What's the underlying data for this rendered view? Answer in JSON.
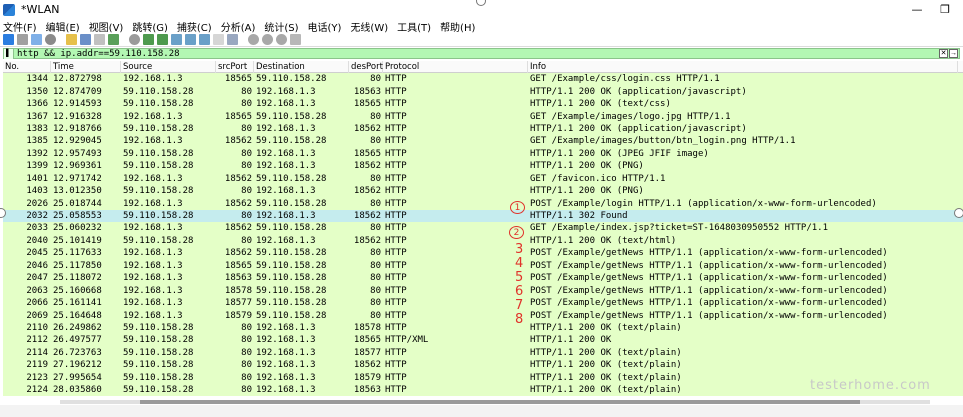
{
  "window": {
    "title": "*WLAN",
    "min": "—",
    "restore": "❐"
  },
  "menu": [
    "文件(F)",
    "编辑(E)",
    "视图(V)",
    "跳转(G)",
    "捕获(C)",
    "分析(A)",
    "统计(S)",
    "电话(Y)",
    "无线(W)",
    "工具(T)",
    "帮助(H)"
  ],
  "filter": {
    "value": "http && ip.addr==59.110.158.28"
  },
  "columns": [
    "No.",
    "Time",
    "Source",
    "srcPort",
    "Destination",
    "desPort",
    "Protocol",
    "Info"
  ],
  "rows": [
    {
      "no": "1344",
      "time": "12.872798",
      "src": "192.168.1.3",
      "sport": "18565",
      "dst": "59.110.158.28",
      "dport": "80",
      "proto": "HTTP",
      "info": "GET /Example/css/login.css HTTP/1.1"
    },
    {
      "no": "1350",
      "time": "12.874709",
      "src": "59.110.158.28",
      "sport": "80",
      "dst": "192.168.1.3",
      "dport": "18563",
      "proto": "HTTP",
      "info": "HTTP/1.1 200 OK  (application/javascript)"
    },
    {
      "no": "1366",
      "time": "12.914593",
      "src": "59.110.158.28",
      "sport": "80",
      "dst": "192.168.1.3",
      "dport": "18565",
      "proto": "HTTP",
      "info": "HTTP/1.1 200 OK  (text/css)"
    },
    {
      "no": "1367",
      "time": "12.916328",
      "src": "192.168.1.3",
      "sport": "18565",
      "dst": "59.110.158.28",
      "dport": "80",
      "proto": "HTTP",
      "info": "GET /Example/images/logo.jpg HTTP/1.1"
    },
    {
      "no": "1383",
      "time": "12.918766",
      "src": "59.110.158.28",
      "sport": "80",
      "dst": "192.168.1.3",
      "dport": "18562",
      "proto": "HTTP",
      "info": "HTTP/1.1 200 OK  (application/javascript)"
    },
    {
      "no": "1385",
      "time": "12.929045",
      "src": "192.168.1.3",
      "sport": "18562",
      "dst": "59.110.158.28",
      "dport": "80",
      "proto": "HTTP",
      "info": "GET /Example/images/button/btn_login.png HTTP/1.1"
    },
    {
      "no": "1392",
      "time": "12.957493",
      "src": "59.110.158.28",
      "sport": "80",
      "dst": "192.168.1.3",
      "dport": "18565",
      "proto": "HTTP",
      "info": "HTTP/1.1 200 OK  (JPEG JFIF image)"
    },
    {
      "no": "1399",
      "time": "12.969361",
      "src": "59.110.158.28",
      "sport": "80",
      "dst": "192.168.1.3",
      "dport": "18562",
      "proto": "HTTP",
      "info": "HTTP/1.1 200 OK  (PNG)"
    },
    {
      "no": "1401",
      "time": "12.971742",
      "src": "192.168.1.3",
      "sport": "18562",
      "dst": "59.110.158.28",
      "dport": "80",
      "proto": "HTTP",
      "info": "GET /favicon.ico HTTP/1.1"
    },
    {
      "no": "1403",
      "time": "13.012350",
      "src": "59.110.158.28",
      "sport": "80",
      "dst": "192.168.1.3",
      "dport": "18562",
      "proto": "HTTP",
      "info": "HTTP/1.1 200 OK  (PNG)"
    },
    {
      "no": "2026",
      "time": "25.018744",
      "src": "192.168.1.3",
      "sport": "18562",
      "dst": "59.110.158.28",
      "dport": "80",
      "proto": "HTTP",
      "info": "POST /Example/login HTTP/1.1  (application/x-www-form-urlencoded)"
    },
    {
      "no": "2032",
      "time": "25.058553",
      "src": "59.110.158.28",
      "sport": "80",
      "dst": "192.168.1.3",
      "dport": "18562",
      "proto": "HTTP",
      "info": "HTTP/1.1 302 Found",
      "selected": true
    },
    {
      "no": "2033",
      "time": "25.060232",
      "src": "192.168.1.3",
      "sport": "18562",
      "dst": "59.110.158.28",
      "dport": "80",
      "proto": "HTTP",
      "info": "GET /Example/index.jsp?ticket=ST-1648030950552 HTTP/1.1"
    },
    {
      "no": "2040",
      "time": "25.101419",
      "src": "59.110.158.28",
      "sport": "80",
      "dst": "192.168.1.3",
      "dport": "18562",
      "proto": "HTTP",
      "info": "HTTP/1.1 200 OK  (text/html)"
    },
    {
      "no": "2045",
      "time": "25.117633",
      "src": "192.168.1.3",
      "sport": "18562",
      "dst": "59.110.158.28",
      "dport": "80",
      "proto": "HTTP",
      "info": "POST /Example/getNews HTTP/1.1  (application/x-www-form-urlencoded)"
    },
    {
      "no": "2046",
      "time": "25.117850",
      "src": "192.168.1.3",
      "sport": "18565",
      "dst": "59.110.158.28",
      "dport": "80",
      "proto": "HTTP",
      "info": "POST /Example/getNews HTTP/1.1  (application/x-www-form-urlencoded)"
    },
    {
      "no": "2047",
      "time": "25.118072",
      "src": "192.168.1.3",
      "sport": "18563",
      "dst": "59.110.158.28",
      "dport": "80",
      "proto": "HTTP",
      "info": "POST /Example/getNews HTTP/1.1  (application/x-www-form-urlencoded)"
    },
    {
      "no": "2063",
      "time": "25.160668",
      "src": "192.168.1.3",
      "sport": "18578",
      "dst": "59.110.158.28",
      "dport": "80",
      "proto": "HTTP",
      "info": "POST /Example/getNews HTTP/1.1  (application/x-www-form-urlencoded)"
    },
    {
      "no": "2066",
      "time": "25.161141",
      "src": "192.168.1.3",
      "sport": "18577",
      "dst": "59.110.158.28",
      "dport": "80",
      "proto": "HTTP",
      "info": "POST /Example/getNews HTTP/1.1  (application/x-www-form-urlencoded)"
    },
    {
      "no": "2069",
      "time": "25.164648",
      "src": "192.168.1.3",
      "sport": "18579",
      "dst": "59.110.158.28",
      "dport": "80",
      "proto": "HTTP",
      "info": "POST /Example/getNews HTTP/1.1  (application/x-www-form-urlencoded)"
    },
    {
      "no": "2110",
      "time": "26.249862",
      "src": "59.110.158.28",
      "sport": "80",
      "dst": "192.168.1.3",
      "dport": "18578",
      "proto": "HTTP",
      "info": "HTTP/1.1 200 OK  (text/plain)"
    },
    {
      "no": "2112",
      "time": "26.497577",
      "src": "59.110.158.28",
      "sport": "80",
      "dst": "192.168.1.3",
      "dport": "18565",
      "proto": "HTTP/XML",
      "info": "HTTP/1.1 200 OK"
    },
    {
      "no": "2114",
      "time": "26.723763",
      "src": "59.110.158.28",
      "sport": "80",
      "dst": "192.168.1.3",
      "dport": "18577",
      "proto": "HTTP",
      "info": "HTTP/1.1 200 OK  (text/plain)"
    },
    {
      "no": "2119",
      "time": "27.196212",
      "src": "59.110.158.28",
      "sport": "80",
      "dst": "192.168.1.3",
      "dport": "18562",
      "proto": "HTTP",
      "info": "HTTP/1.1 200 OK  (text/plain)"
    },
    {
      "no": "2123",
      "time": "27.995654",
      "src": "59.110.158.28",
      "sport": "80",
      "dst": "192.168.1.3",
      "dport": "18579",
      "proto": "HTTP",
      "info": "HTTP/1.1 200 OK  (text/plain)"
    },
    {
      "no": "2124",
      "time": "28.035860",
      "src": "59.110.158.28",
      "sport": "80",
      "dst": "192.168.1.3",
      "dport": "18563",
      "proto": "HTTP",
      "info": "HTTP/1.1 200 OK  (text/plain)"
    }
  ],
  "annotations": [
    "1",
    "2",
    "3",
    "4",
    "5",
    "6",
    "7",
    "8"
  ],
  "watermark": "testerhome.com",
  "colors": {
    "http_row": "#e4ffc7",
    "selected_row": "#c5ecee",
    "filter_bg": "#b3f7b3",
    "annotation": "#e0332b"
  }
}
